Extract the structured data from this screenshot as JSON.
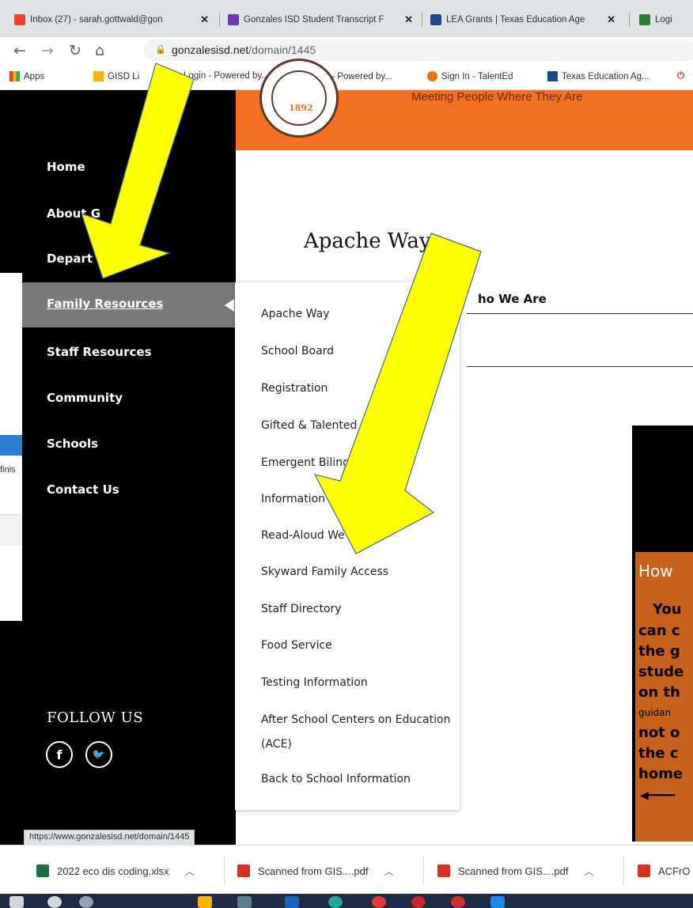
{
  "browser": {
    "tabs": [
      {
        "title": "Inbox (27) - sarah.gottwald@gon",
        "icon": "gmail-icon",
        "icon_color": "#ea4335"
      },
      {
        "title": "Gonzales ISD Student Transcript F",
        "icon": "forms-icon",
        "icon_color": "#673ab7"
      },
      {
        "title": "LEA Grants | Texas Education Age",
        "icon": "tea-icon",
        "icon_color": "#1a4a8a"
      },
      {
        "title": "Logi",
        "icon": "login-icon",
        "icon_color": "#2f7d32"
      }
    ],
    "url_domain": "gonzalesisd.net",
    "url_path": "/domain/1445",
    "bookmarks": [
      {
        "label": "Apps",
        "icon": "apps-grid-icon"
      },
      {
        "label": "GISD Li",
        "icon": "folder-icon"
      },
      {
        "label": "Login - Powered by...",
        "icon": "login-icon"
      },
      {
        "label": "Login - Powered by...",
        "icon": "login-icon"
      },
      {
        "label": "Sign In - TalentEd",
        "icon": "talented-icon"
      },
      {
        "label": "Texas Education Ag...",
        "icon": "texas-icon"
      }
    ]
  },
  "site": {
    "tagline": "Meeting People Where They Are",
    "seal_year": "1892",
    "accent_color": "#f36f21"
  },
  "sidebar": {
    "items": [
      {
        "label": "Home"
      },
      {
        "label": "About G"
      },
      {
        "label": "Depart"
      },
      {
        "label": "Family Resources",
        "active": true
      },
      {
        "label": "Staff Resources"
      },
      {
        "label": "Community"
      },
      {
        "label": "Schools"
      },
      {
        "label": "Contact Us"
      }
    ],
    "follow_label": "FOLLOW US",
    "social": [
      {
        "glyph": "f",
        "icon": "facebook-icon"
      },
      {
        "glyph": "🐦",
        "icon": "twitter-icon"
      }
    ]
  },
  "dropdown": {
    "items": [
      "Apache Way",
      "School Board",
      "Registration",
      "Gifted & Talented",
      "Emergent Biling",
      "Information",
      "Read-Aloud We",
      "Skyward Family Access",
      "Staff Directory",
      "Food Service",
      "Testing Information",
      "After School Centers on Education",
      "(ACE)",
      "Back to School Information"
    ]
  },
  "content": {
    "page_title": "Apache Way",
    "section_label": "ho We Are",
    "poster_heading": "How",
    "poster_lines": [
      "You",
      "can c",
      "the g",
      "stude",
      "on th",
      "guidan",
      "not o",
      "the c",
      "home"
    ]
  },
  "underlay": {
    "text": "finis"
  },
  "status_url": "https://www.gonzalesisd.net/domain/1445",
  "downloads": [
    {
      "name": "2022 eco dis coding.xlsx",
      "icon": "excel-icon",
      "color": "#1d6f42"
    },
    {
      "name": "Scanned from GIS....pdf",
      "icon": "pdf-icon",
      "color": "#d93025"
    },
    {
      "name": "Scanned from GIS....pdf",
      "icon": "pdf-icon",
      "color": "#d93025"
    },
    {
      "name": "ACFrO",
      "icon": "pdf-icon",
      "color": "#d93025"
    }
  ],
  "annotation_color": "#ffff00"
}
